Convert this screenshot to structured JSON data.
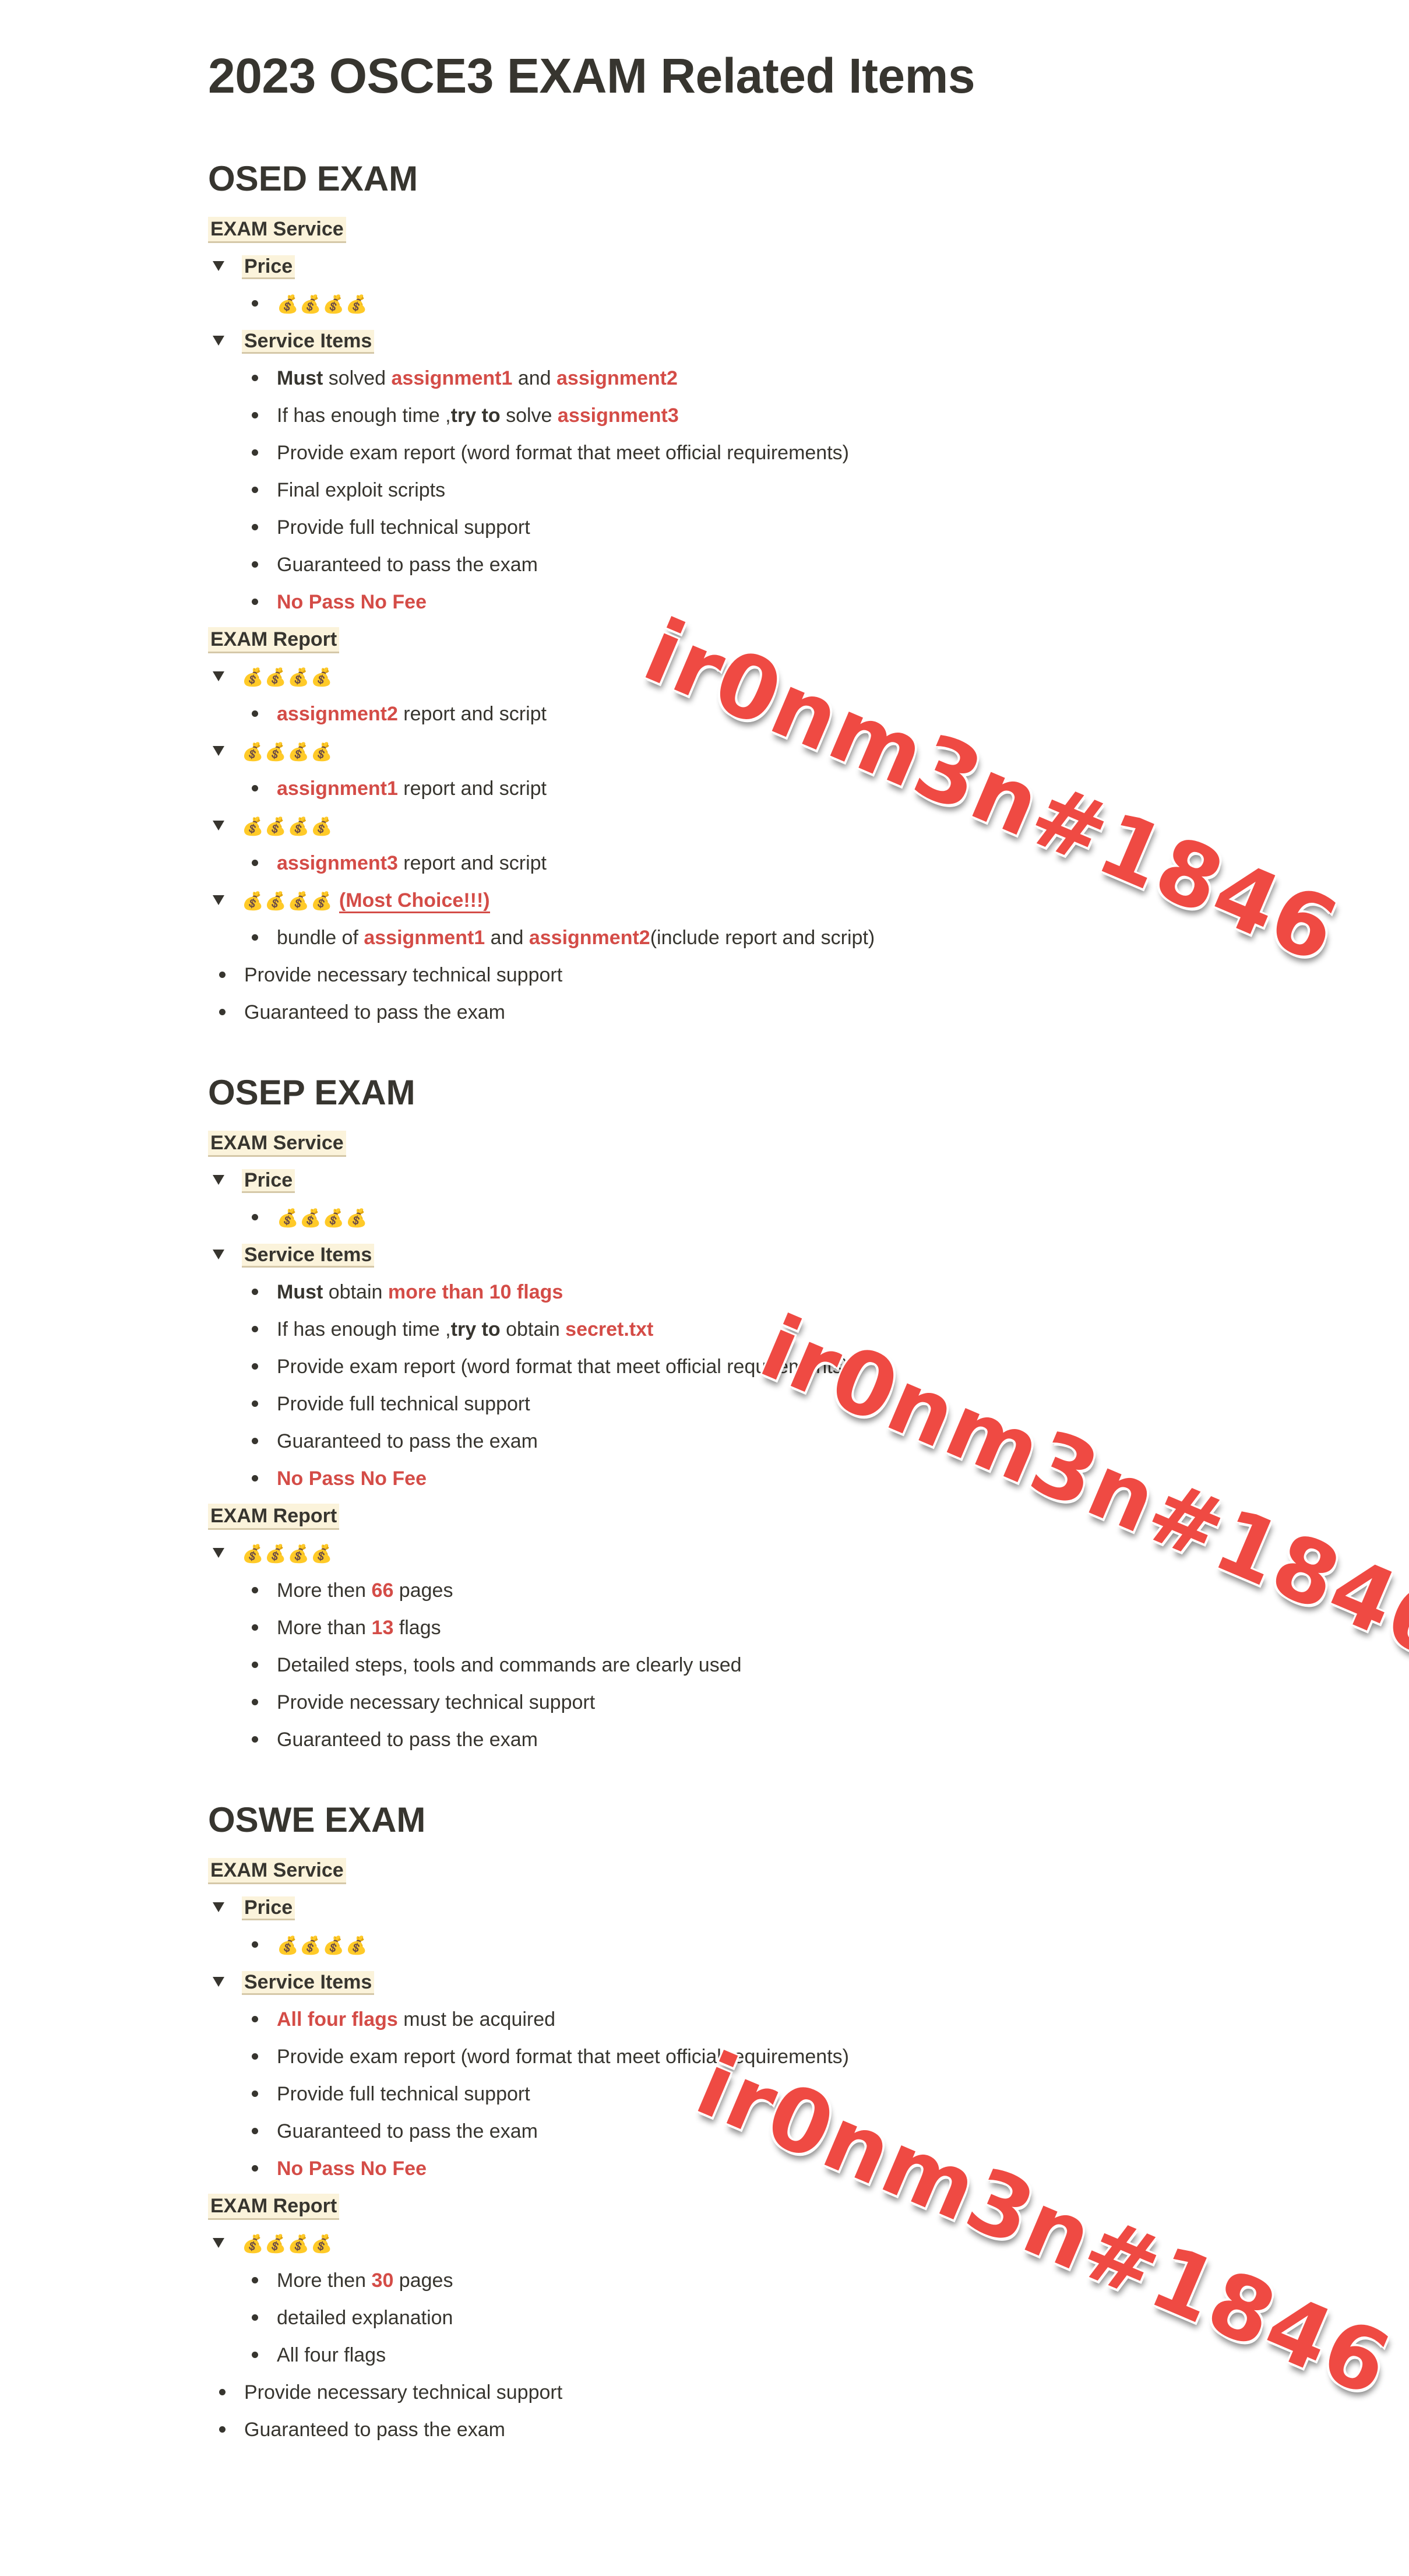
{
  "title": "2023 OSCE3 EXAM Related Items",
  "money": "💰💰💰💰",
  "watermark": "ir0nm3n#1846",
  "osed": {
    "heading": "OSED EXAM",
    "service_tag": "EXAM Service",
    "price_label": "Price",
    "service_items_label": "Service Items",
    "items": {
      "i1_a": "Must",
      "i1_b": " solved ",
      "i1_c": "assignment1",
      "i1_d": " and ",
      "i1_e": "assignment2",
      "i2_a": "If has enough time ,",
      "i2_b": "try to",
      "i2_c": " solve ",
      "i2_d": "assignment3",
      "i3": "Provide exam report (word format that meet official requirements)",
      "i4": "Final exploit scripts",
      "i5": "Provide full technical support",
      "i6": "Guaranteed to pass the exam",
      "i7": "No Pass No Fee"
    },
    "report_tag": "EXAM Report",
    "report": {
      "r1_a": "assignment2",
      "r1_b": " report and script",
      "r2_a": "assignment1",
      "r2_b": " report and script",
      "r3_a": "assignment3",
      "r3_b": " report and script",
      "r4_label": "(Most Choice!!!)",
      "r4_a": "bundle of ",
      "r4_b": "assignment1",
      "r4_c": " and ",
      "r4_d": "assignment2",
      "r4_e": "(include report and script)",
      "r5": "Provide necessary technical support",
      "r6": "Guaranteed to pass the exam"
    }
  },
  "osep": {
    "heading": "OSEP EXAM",
    "service_tag": "EXAM Service",
    "price_label": "Price",
    "service_items_label": "Service Items",
    "items": {
      "i1_a": "Must",
      "i1_b": " obtain ",
      "i1_c": "more than 10 flags",
      "i2_a": "If has enough time ,",
      "i2_b": "try to",
      "i2_c": " obtain ",
      "i2_d": "secret.txt",
      "i3": "Provide exam report (word format that meet official requirements)",
      "i4": "Provide full technical support",
      "i5": "Guaranteed to pass the exam",
      "i6": "No Pass No Fee"
    },
    "report_tag": "EXAM Report",
    "report": {
      "r1_a": "More then ",
      "r1_b": "66",
      "r1_c": " pages",
      "r2_a": "More than ",
      "r2_b": "13",
      "r2_c": " flags",
      "r3": "Detailed steps, tools and commands are clearly used",
      "r4": "Provide necessary technical support",
      "r5": "Guaranteed to pass the exam"
    }
  },
  "oswe": {
    "heading": "OSWE EXAM",
    "service_tag": "EXAM Service",
    "price_label": "Price",
    "service_items_label": "Service Items",
    "items": {
      "i1_a": "All four flags",
      "i1_b": " must be acquired",
      "i2": "Provide exam report (word format that meet official requirements)",
      "i3": "Provide full technical support",
      "i4": "Guaranteed to pass the exam",
      "i5": "No Pass No Fee"
    },
    "report_tag": "EXAM Report",
    "report": {
      "r1_a": "More then ",
      "r1_b": "30",
      "r1_c": " pages",
      "r2": "detailed explanation",
      "r3": "All four flags",
      "r4": "Provide necessary technical support",
      "r5": "Guaranteed to pass the exam"
    }
  }
}
